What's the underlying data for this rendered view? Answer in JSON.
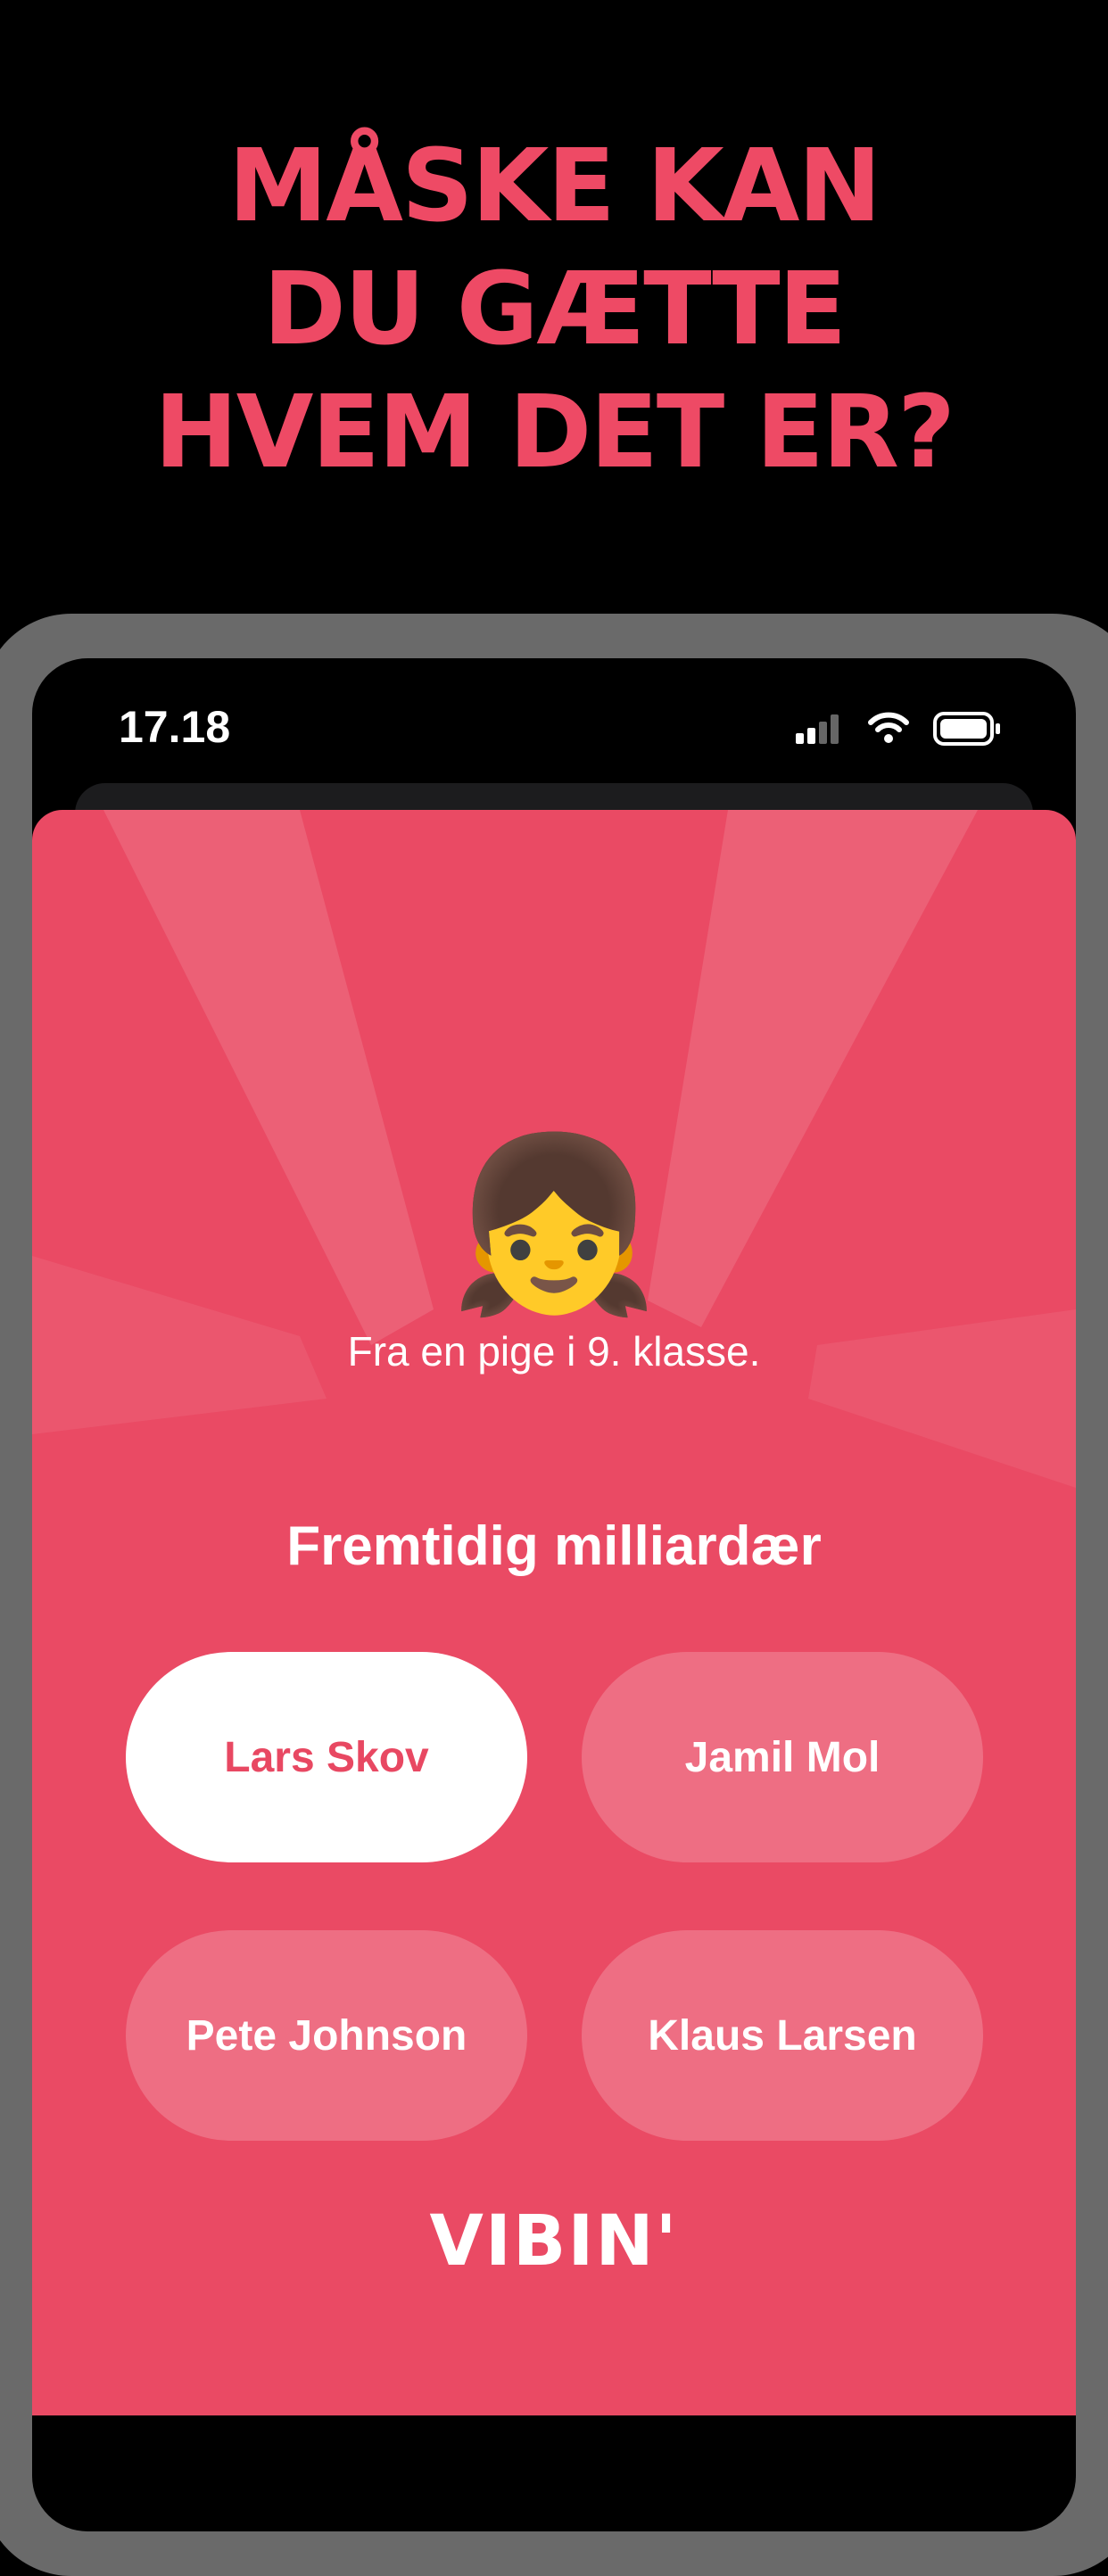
{
  "headline": {
    "line1": "MÅSKE KAN",
    "line2": "DU GÆTTE",
    "line3": "HVEM DET ER?"
  },
  "status_bar": {
    "time": "17.18",
    "icons": [
      "signal-icon",
      "wifi-icon",
      "battery-icon"
    ]
  },
  "card": {
    "emoji": "👧",
    "emoji_name": "girl-emoji",
    "subtitle": "Fra en pige i 9. klasse.",
    "question": "Fremtidig milliardær",
    "options": [
      {
        "label": "Lars Skov",
        "selected": true
      },
      {
        "label": "Jamil Mol",
        "selected": false
      },
      {
        "label": "Pete Johnson",
        "selected": false
      },
      {
        "label": "Klaus Larsen",
        "selected": false
      }
    ],
    "logo": "VIBIN'"
  },
  "colors": {
    "accent": "#EE4A65",
    "card_bg": "#EA4A64",
    "phone_frame": "#6a6a6a",
    "background": "#000000"
  }
}
